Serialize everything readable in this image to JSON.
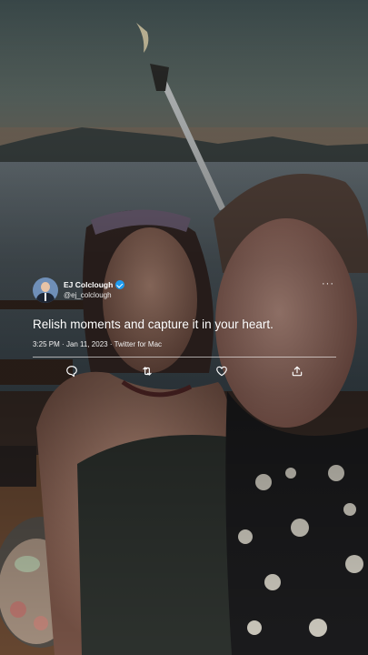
{
  "tweet": {
    "display_name": "EJ Colclough",
    "handle": "@ej_colclough",
    "text": "Relish moments and capture it in your heart.",
    "time": "3:25 PM",
    "separator": "·",
    "date": "Jan 11, 2023",
    "source": "Twitter for Mac",
    "more_label": "···",
    "verified": true
  },
  "icons": {
    "avatar": "profile-photo",
    "verified": "verified-badge-icon",
    "more": "more-options-icon",
    "reply": "reply-icon",
    "retweet": "retweet-icon",
    "like": "heart-icon",
    "share": "share-icon"
  },
  "colors": {
    "text": "#ffffff",
    "verified_badge": "#1d9bf0"
  }
}
